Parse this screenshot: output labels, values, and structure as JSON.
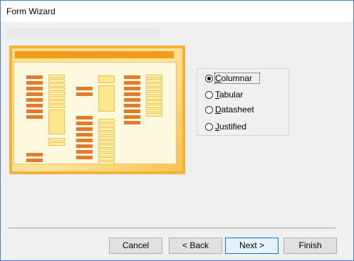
{
  "window": {
    "title": "Form Wizard"
  },
  "layout_options": [
    {
      "label": "Columnar",
      "selected": true,
      "mnemonic": "C"
    },
    {
      "label": "Tabular",
      "selected": false,
      "mnemonic": "T"
    },
    {
      "label": "Datasheet",
      "selected": false,
      "mnemonic": "D"
    },
    {
      "label": "Justified",
      "selected": false,
      "mnemonic": "J"
    }
  ],
  "buttons": {
    "cancel": "Cancel",
    "back": "< Back",
    "next": "Next >",
    "finish": "Finish"
  },
  "colors": {
    "accent_orange": "#f29b1f",
    "preview_panel": "#fff9df",
    "selection_blue": "#0078d7"
  }
}
